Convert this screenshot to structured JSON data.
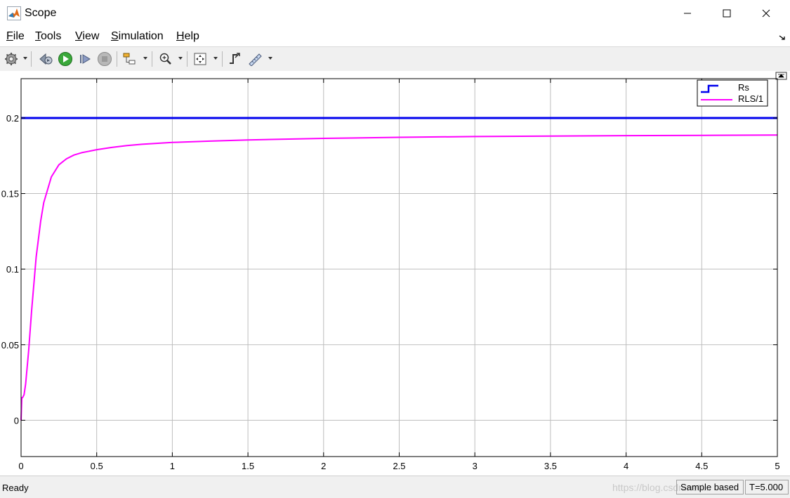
{
  "window": {
    "title": "Scope"
  },
  "menu": [
    "File",
    "Tools",
    "View",
    "Simulation",
    "Help"
  ],
  "toolbar_icons": [
    "settings-icon",
    "rewind-icon",
    "run-icon",
    "step-forward-icon",
    "stop-icon",
    "highlight-block-icon",
    "zoom-in-icon",
    "fit-view-icon",
    "triggers-icon",
    "cursor-measurements-icon"
  ],
  "status": {
    "left": "Ready",
    "mode": "Sample based",
    "time": "T=5.000",
    "watermark": "https://blog.csdn.net/..."
  },
  "colors": {
    "rs": "#0000ee",
    "rls": "#ff00ff",
    "grid": "#bdbdbd"
  },
  "chart_data": {
    "type": "line",
    "xlim": [
      0,
      5
    ],
    "ylim": [
      -0.024,
      0.226
    ],
    "x_ticks": [
      "0",
      "0.5",
      "1",
      "1.5",
      "2",
      "2.5",
      "3",
      "3.5",
      "4",
      "4.5",
      "5"
    ],
    "y_ticks": [
      "0",
      "0.05",
      "0.1",
      "0.15",
      "0.2"
    ],
    "grid": true,
    "legend_position": "top-right",
    "legend": [
      "Rs",
      "RLS/1"
    ],
    "series": [
      {
        "name": "Rs",
        "x": [
          0,
          5
        ],
        "y": [
          0.2,
          0.2
        ]
      },
      {
        "name": "RLS/1",
        "x": [
          0,
          0.005,
          0.01,
          0.02,
          0.03,
          0.05,
          0.07,
          0.1,
          0.13,
          0.15,
          0.2,
          0.25,
          0.3,
          0.35,
          0.4,
          0.45,
          0.5,
          0.6,
          0.7,
          0.8,
          1.0,
          1.25,
          1.5,
          2.0,
          2.5,
          3.0,
          3.5,
          4.0,
          4.5,
          5.0
        ],
        "y": [
          0,
          0.015,
          0.015,
          0.017,
          0.024,
          0.046,
          0.073,
          0.108,
          0.132,
          0.144,
          0.161,
          0.169,
          0.173,
          0.1755,
          0.177,
          0.178,
          0.179,
          0.1805,
          0.1817,
          0.1826,
          0.1838,
          0.1847,
          0.1855,
          0.1865,
          0.1872,
          0.1877,
          0.188,
          0.1883,
          0.1885,
          0.1887
        ]
      }
    ]
  }
}
